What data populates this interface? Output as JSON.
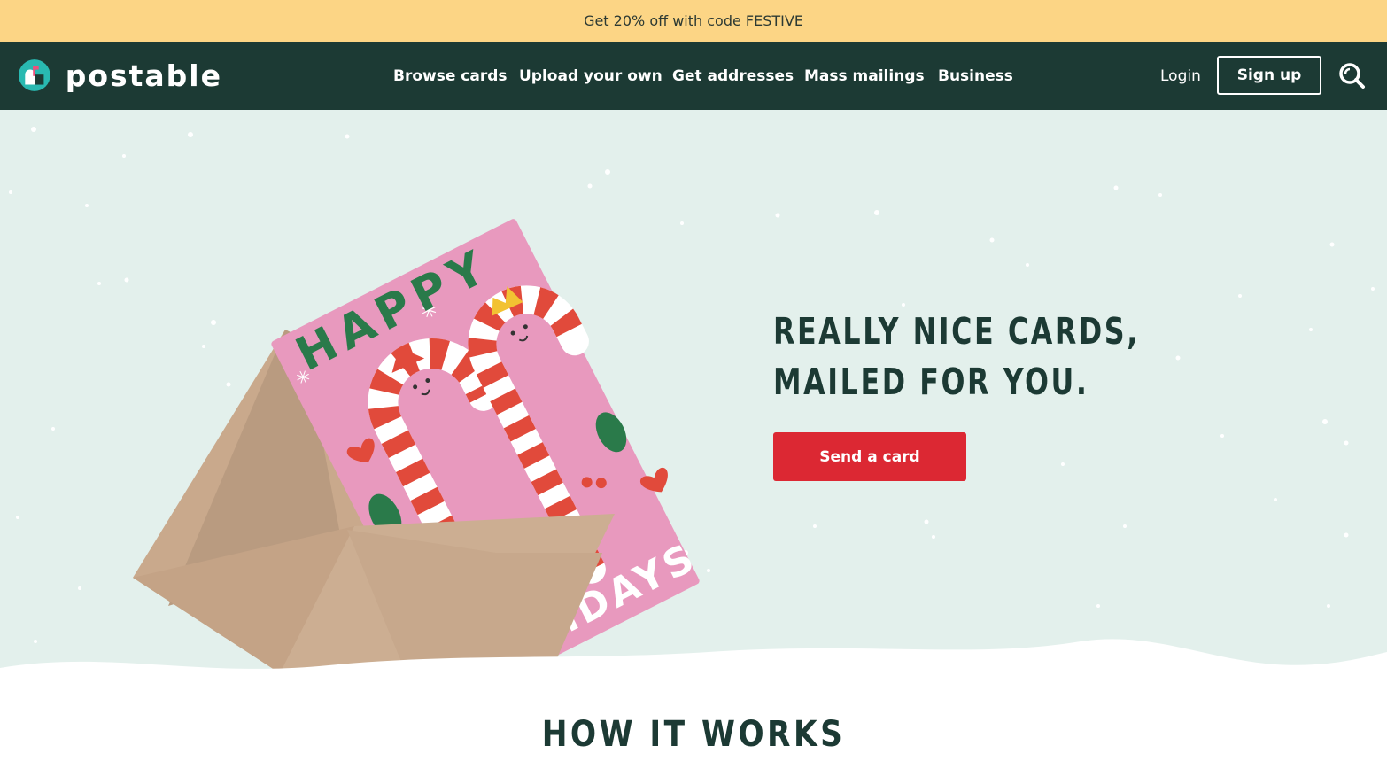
{
  "promo": {
    "text": "Get 20% off with code FESTIVE"
  },
  "brand": {
    "name": "postable"
  },
  "nav": {
    "links": [
      "Browse cards",
      "Upload your own",
      "Get addresses",
      "Mass mailings",
      "Business"
    ],
    "login": "Login",
    "signup": "Sign up"
  },
  "hero": {
    "headline_line1": "REALLY NICE CARDS,",
    "headline_line2": "MAILED FOR YOU.",
    "cta": "Send a card",
    "card": {
      "word1": "HAPPY",
      "word2": "HOLIDAYS"
    }
  },
  "how_it_works": {
    "title": "HOW IT WORKS"
  },
  "colors": {
    "promo_bg": "#fcd585",
    "nav_bg": "#1c3a34",
    "hero_bg": "#e3f0ec",
    "cta_bg": "#dc2833",
    "card_pink": "#e899be"
  }
}
